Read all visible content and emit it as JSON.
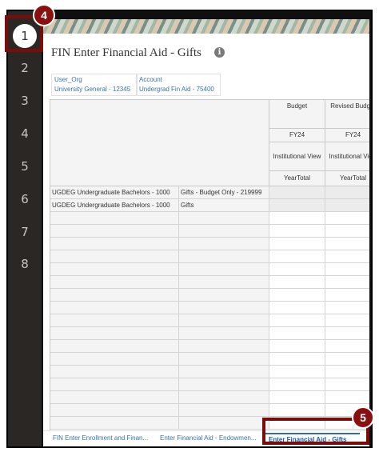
{
  "rail": {
    "items": [
      "1",
      "2",
      "3",
      "4",
      "5",
      "6",
      "7",
      "8"
    ],
    "active_index": 0
  },
  "form": {
    "title": "FIN Enter Financial Aid - Gifts",
    "info_icon": "i"
  },
  "pov": [
    {
      "label": "User_Org",
      "value": "University General - 12345"
    },
    {
      "label": "Account",
      "value": "Undergrad Fin Aid - 75400"
    }
  ],
  "grid": {
    "columns": [
      {
        "header": "Budget",
        "year": "FY24",
        "view": "Institutional View",
        "period": "YearTotal"
      },
      {
        "header": "Revised Budget",
        "year": "FY24",
        "view": "Institutional View",
        "period": "YearTotal"
      }
    ],
    "rows": [
      {
        "level1": "UGDEG Undergraduate Bachelors - 1000",
        "level2": "Gifts - Budget Only - 219999",
        "values": [
          "",
          ""
        ]
      },
      {
        "level1": "UGDEG Undergraduate Bachelors - 1000",
        "level2": "Gifts",
        "values": [
          "",
          ""
        ]
      }
    ],
    "empty_row_count": 17
  },
  "tabs": [
    {
      "label": "FIN Enter Enrollment and Finan..."
    },
    {
      "label": "Enter Financial Aid - Endowmen..."
    },
    {
      "label": "Enter Financial Aid - Gifts",
      "active": true
    }
  ],
  "callouts": [
    {
      "number": "4"
    },
    {
      "number": "5"
    }
  ],
  "colors": {
    "rail_bg": "#2b2724",
    "callout": "#8a1010",
    "link": "#3b73a8"
  }
}
